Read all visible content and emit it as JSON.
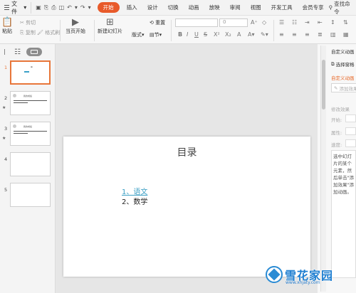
{
  "menubar": {
    "file_label": "文件",
    "tabs": [
      "开始",
      "插入",
      "设计",
      "切换",
      "动画",
      "放映",
      "审阅",
      "视图",
      "开发工具",
      "会员专享"
    ],
    "active_tab": "开始",
    "search_label": "查找命令"
  },
  "ribbon": {
    "paste": "粘贴",
    "cut": "剪切",
    "copy": "复制",
    "format_painter": "格式刷",
    "from_current": "当页开始",
    "new_slide": "新建幻灯片",
    "layout": "版式",
    "section": "节",
    "reset": "重置",
    "font_size": "0"
  },
  "slides": [
    {
      "num": "1",
      "selected": true
    },
    {
      "num": "2",
      "star": "★",
      "title": "我的成绩"
    },
    {
      "num": "3",
      "star": "★",
      "title": "我的成绩"
    },
    {
      "num": "4"
    },
    {
      "num": "5"
    }
  ],
  "slide": {
    "title": "目录",
    "items": [
      "1、语文",
      "2、数学"
    ]
  },
  "right_panel": {
    "title": "自定义动画",
    "select_pane": "选择窗格",
    "custom_anim": "自定义动画",
    "add_effect": "添加效果",
    "modify_effect": "修改效果",
    "start_label": "开始:",
    "property_label": "属性:",
    "speed_label": "速度:",
    "hint": "选中幻灯片的某个元素，然后单击\"添加效果\"添加动画。"
  },
  "watermark": {
    "name": "雪花家园",
    "url": "www.xhjaty.com"
  }
}
